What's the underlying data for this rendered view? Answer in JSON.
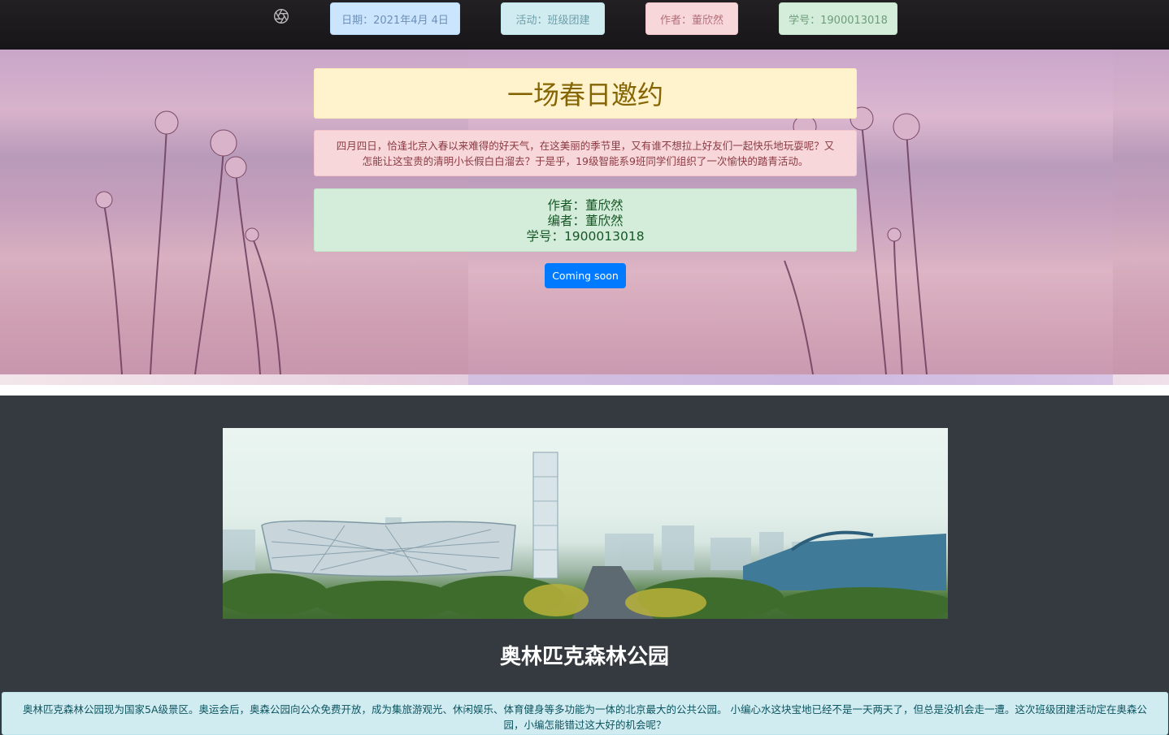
{
  "nav": {
    "date": "日期：2021年4月 4日",
    "activity": "活动：班级团建",
    "author": "作者：董欣然",
    "student_id": "学号：1900013018"
  },
  "hero": {
    "title": "一场春日邀约",
    "intro": "四月四日，恰逢北京入春以来难得的好天气，在这美丽的季节里，又有谁不想拉上好友们一起快乐地玩耍呢？又怎能让这宝贵的清明小长假白白溜去？于是乎，19级智能系9班同学们组织了一次愉快的踏青活动。",
    "author_line": "作者：董欣然",
    "editor_line": "编者：董欣然",
    "student_line": "学号：1900013018",
    "button_label": "Coming soon"
  },
  "park": {
    "title": "奥林匹克森林公园",
    "description": "奥林匹克森林公园现为国家5A级景区。奥运会后，奥森公园向公众免费开放，成为集旅游观光、休闲娱乐、体育健身等多功能为一体的北京最大的公共公园。 小编心水这块宝地已经不是一天两天了，但总是没机会走一遭。这次班级团建活动定在奥森公园，小编怎能错过这大好的机会呢？"
  },
  "icons": {
    "logo": "aperture-icon"
  },
  "colors": {
    "primary_button": "#007bff",
    "dark_section": "#343a40"
  }
}
